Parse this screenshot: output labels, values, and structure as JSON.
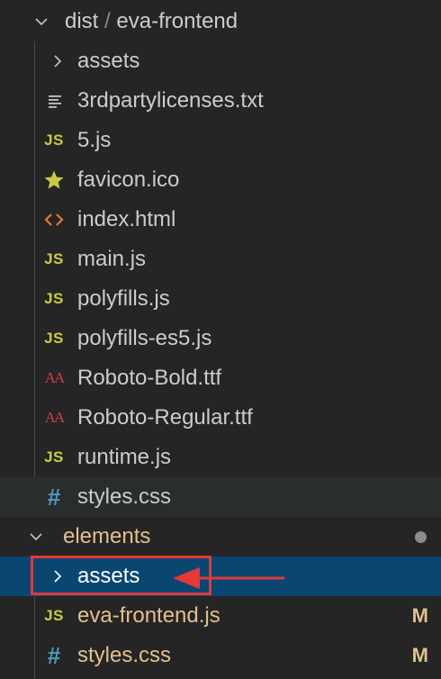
{
  "header": {
    "folder": "dist",
    "separator": "/",
    "subfolder": "eva-frontend"
  },
  "dist_items": [
    {
      "label": "assets",
      "icon": "chevron-right-icon"
    },
    {
      "label": "3rdpartylicenses.txt",
      "icon": "text-file-icon"
    },
    {
      "label": "5.js",
      "icon": "js-icon",
      "icon_text": "JS"
    },
    {
      "label": "favicon.ico",
      "icon": "star-icon"
    },
    {
      "label": "index.html",
      "icon": "html-icon"
    },
    {
      "label": "main.js",
      "icon": "js-icon",
      "icon_text": "JS"
    },
    {
      "label": "polyfills.js",
      "icon": "js-icon",
      "icon_text": "JS"
    },
    {
      "label": "polyfills-es5.js",
      "icon": "js-icon",
      "icon_text": "JS"
    },
    {
      "label": "Roboto-Bold.ttf",
      "icon": "font-icon",
      "icon_text": "AA"
    },
    {
      "label": "Roboto-Regular.ttf",
      "icon": "font-icon",
      "icon_text": "AA"
    },
    {
      "label": "runtime.js",
      "icon": "js-icon",
      "icon_text": "JS"
    },
    {
      "label": "styles.css",
      "icon": "css-icon",
      "icon_text": "#"
    }
  ],
  "elements": {
    "label": "elements",
    "items": [
      {
        "label": "assets",
        "icon": "chevron-right-icon"
      },
      {
        "label": "eva-frontend.js",
        "icon": "js-icon",
        "icon_text": "JS",
        "badge": "M"
      },
      {
        "label": "styles.css",
        "icon": "css-icon",
        "icon_text": "#",
        "badge": "M"
      }
    ]
  },
  "colors": {
    "background": "#252526",
    "selected": "#094771",
    "modified": "#e2c08d",
    "js": "#cbcb41",
    "css": "#519aba",
    "html": "#e37933",
    "font": "#cc3e44",
    "star": "#cbcb41",
    "annotation": "#e53935"
  }
}
